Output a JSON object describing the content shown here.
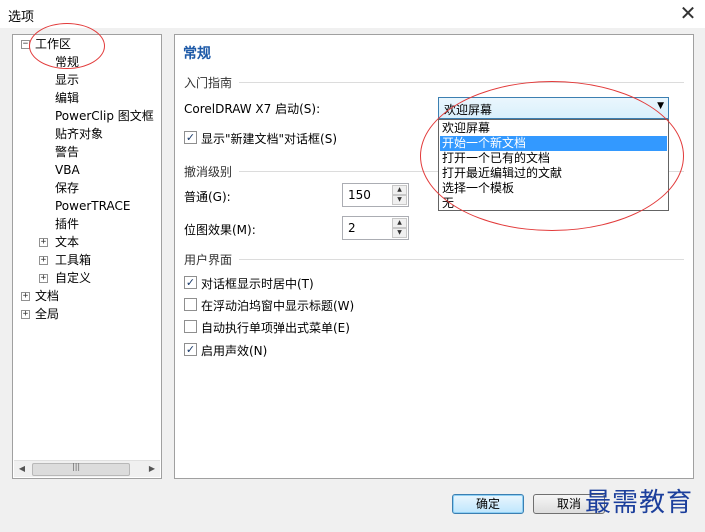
{
  "window": {
    "title": "选项",
    "close_glyph": "✕"
  },
  "tree": {
    "items": [
      {
        "label": "工作区",
        "expander": "−"
      },
      {
        "label": "常规"
      },
      {
        "label": "显示"
      },
      {
        "label": "编辑"
      },
      {
        "label": "PowerClip 图文框"
      },
      {
        "label": "贴齐对象"
      },
      {
        "label": "警告"
      },
      {
        "label": "VBA"
      },
      {
        "label": "保存"
      },
      {
        "label": "PowerTRACE"
      },
      {
        "label": "插件"
      },
      {
        "label": "文本",
        "expander": "+"
      },
      {
        "label": "工具箱",
        "expander": "+"
      },
      {
        "label": "自定义",
        "expander": "+"
      },
      {
        "label": "文档",
        "expander": "+"
      },
      {
        "label": "全局",
        "expander": "+"
      }
    ],
    "scroll_left": "◀",
    "scroll_right": "▶",
    "scroll_thumb_grip": "|||"
  },
  "panel": {
    "title": "常规",
    "startup_group": "入门指南",
    "startup_label": "CorelDRAW X7 启动(S):",
    "startup_value": "欢迎屏幕",
    "dropdown_arrow": "▼",
    "dropdown_options": [
      "欢迎屏幕",
      "开始一个新文档",
      "打开一个已有的文档",
      "打开最近编辑过的文献",
      "选择一个模板",
      "无"
    ],
    "dropdown_selected_index": 1,
    "show_new_doc_dialog": {
      "label": "显示\"新建文档\"对话框(S)",
      "checked": true
    },
    "undo_group": "撤消级别",
    "normal_label": "普通(G):",
    "normal_value": "150",
    "bitmap_label": "位图效果(M):",
    "bitmap_value": "2",
    "spin_up": "▲",
    "spin_down": "▼",
    "ui_group": "用户界面",
    "options": [
      {
        "label": "对话框显示时居中(T)",
        "checked": true
      },
      {
        "label": "在浮动泊坞窗中显示标题(W)",
        "checked": false
      },
      {
        "label": "自动执行单项弹出式菜单(E)",
        "checked": false
      },
      {
        "label": "启用声效(N)",
        "checked": true
      }
    ],
    "check_glyph": "✓"
  },
  "buttons": {
    "ok": "确定",
    "cancel": "取消"
  },
  "watermark": "最需教育"
}
